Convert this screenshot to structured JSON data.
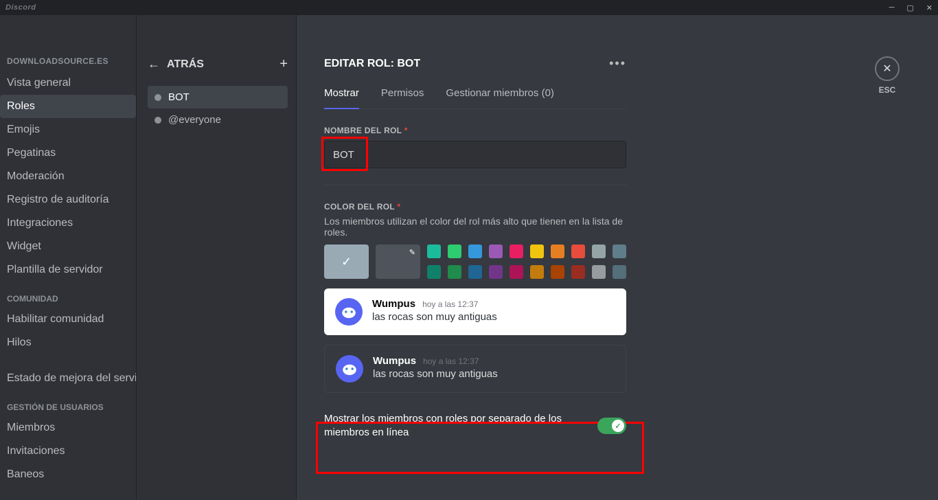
{
  "titlebar": {
    "brand": "Discord"
  },
  "esc_label": "ESC",
  "sidebar": {
    "server_name": "DOWNLOADSOURCE.ES",
    "items": [
      {
        "label": "Vista general"
      },
      {
        "label": "Roles",
        "active": true
      },
      {
        "label": "Emojis"
      },
      {
        "label": "Pegatinas"
      },
      {
        "label": "Moderación"
      },
      {
        "label": "Registro de auditoría"
      },
      {
        "label": "Integraciones"
      },
      {
        "label": "Widget"
      },
      {
        "label": "Plantilla de servidor"
      }
    ],
    "group_community": "COMUNIDAD",
    "community_items": [
      {
        "label": "Habilitar comunidad"
      },
      {
        "label": "Hilos"
      },
      {
        "label": "Estado de mejora del servic"
      }
    ],
    "group_users": "GESTIÓN DE USUARIOS",
    "user_items": [
      {
        "label": "Miembros"
      },
      {
        "label": "Invitaciones"
      },
      {
        "label": "Baneos"
      }
    ]
  },
  "roles_panel": {
    "back_label": "ATRÁS",
    "items": [
      {
        "label": "BOT",
        "active": true
      },
      {
        "label": "@everyone"
      }
    ]
  },
  "editor": {
    "title": "EDITAR ROL: BOT",
    "tabs": [
      {
        "label": "Mostrar",
        "active": true
      },
      {
        "label": "Permisos"
      },
      {
        "label": "Gestionar miembros (0)"
      }
    ],
    "role_name_label": "NOMBRE DEL ROL",
    "role_name_value": "BOT",
    "role_color_label": "COLOR DEL ROL",
    "role_color_helper": "Los miembros utilizan el color del rol más alto que tienen en la lista de roles.",
    "colors_row1": [
      "#1abc9c",
      "#2ecc71",
      "#3498db",
      "#9b59b6",
      "#e91e63",
      "#f1c40f",
      "#e67e22",
      "#e74c3c",
      "#95a5a6",
      "#607d8b"
    ],
    "colors_row2": [
      "#11806a",
      "#1f8b4c",
      "#206694",
      "#71368a",
      "#ad1457",
      "#c27c0e",
      "#a84300",
      "#992d22",
      "#979c9f",
      "#546e7a"
    ],
    "preview": {
      "name": "Wumpus",
      "time": "hoy a las 12:37",
      "body": "las rocas son muy antiguas"
    },
    "toggle_label": "Mostrar los miembros con roles por separado de los miembros en línea"
  }
}
